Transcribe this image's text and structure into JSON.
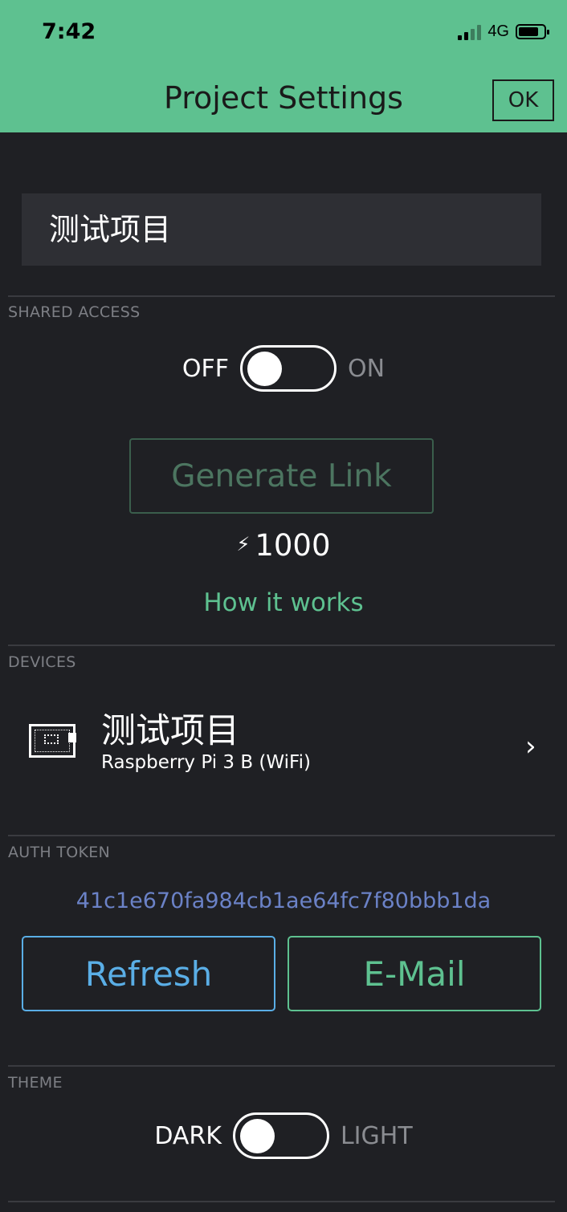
{
  "status_bar": {
    "time": "7:42",
    "network": "4G"
  },
  "header": {
    "title": "Project Settings",
    "ok_label": "OK"
  },
  "project": {
    "name": "测试项目"
  },
  "shared_access": {
    "label": "SHARED ACCESS",
    "toggle_off_label": "OFF",
    "toggle_on_label": "ON",
    "enabled": false,
    "generate_link_label": "Generate Link",
    "energy_icon": "⚡",
    "energy_cost": "1000",
    "how_it_works_label": "How it works"
  },
  "devices": {
    "label": "DEVICES",
    "items": [
      {
        "name": "测试项目",
        "type": "Raspberry Pi 3 B (WiFi)",
        "icon": "board-icon"
      }
    ]
  },
  "auth_token": {
    "label": "AUTH TOKEN",
    "value": "41c1e670fa984cb1ae64fc7f80bbb1da",
    "refresh_label": "Refresh",
    "email_label": "E-Mail"
  },
  "theme": {
    "label": "THEME",
    "dark_label": "DARK",
    "light_label": "LIGHT",
    "selected": "DARK"
  },
  "colors": {
    "accent_green": "#5ec190",
    "accent_blue": "#5aaee6",
    "token_blue": "#6b82c7",
    "background": "#1f2024"
  }
}
